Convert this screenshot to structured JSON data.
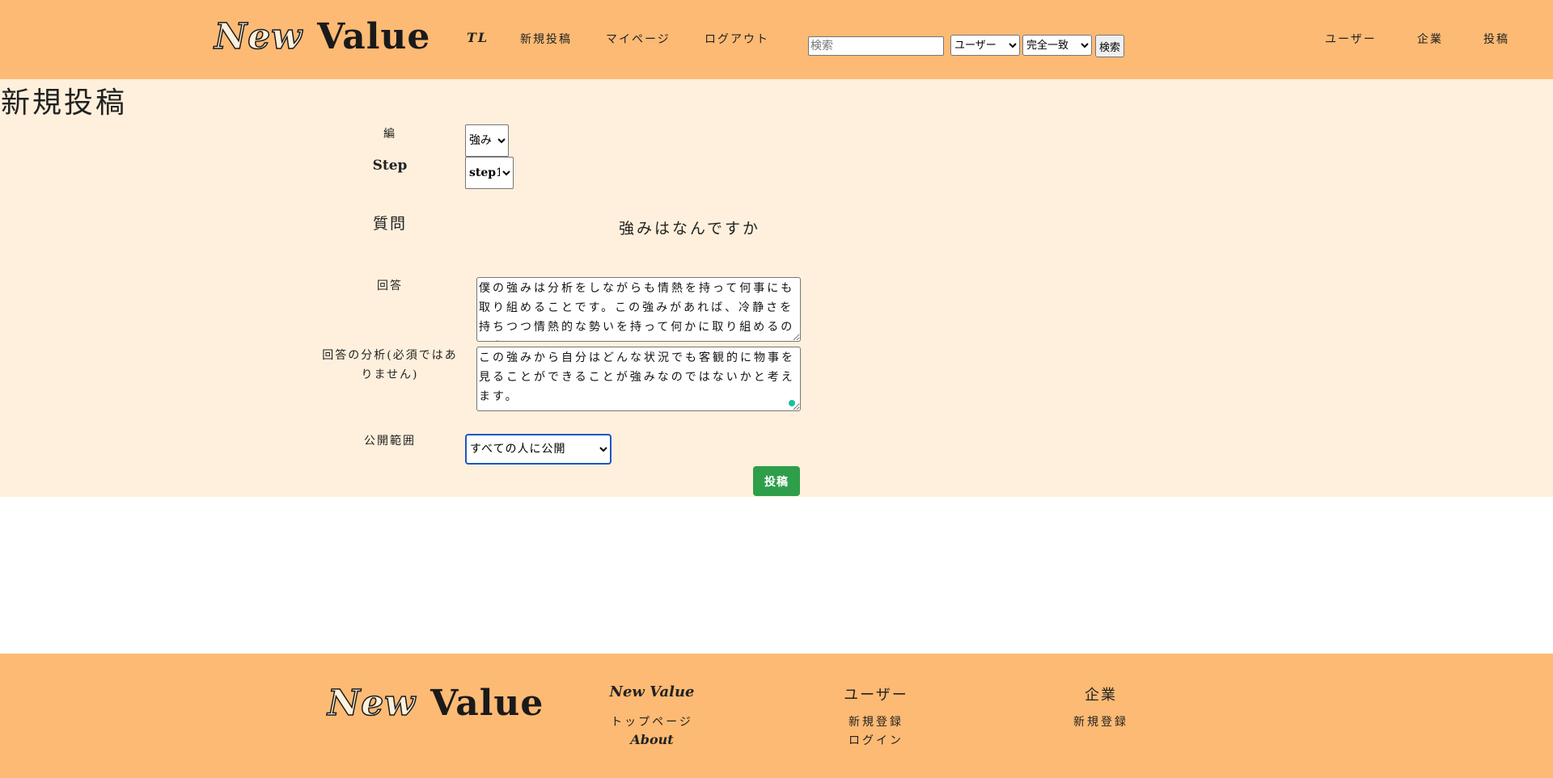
{
  "header": {
    "logo": {
      "word1": "New",
      "word2": "Value"
    },
    "nav": {
      "tl": "TL",
      "new_post": "新規投稿",
      "mypage": "マイページ",
      "logout": "ログアウト"
    },
    "search": {
      "placeholder": "検索",
      "type_selected": "ユーザー",
      "match_selected": "完全一致",
      "button": "検索"
    },
    "right_nav": {
      "users": "ユーザー",
      "companies": "企業",
      "posts": "投稿"
    }
  },
  "main": {
    "title": "新規投稿",
    "form": {
      "hen_label": "編",
      "hen_selected": "強み",
      "step_label": "Step",
      "step_selected": "step1",
      "question_label": "質問",
      "question_text": "強みはなんですか",
      "answer_label": "回答",
      "answer_value": "僕の強みは分析をしながらも情熱を持って何事にも取り組めることです。この強みがあれば、冷静さを持ちつつ情熱的な勢いを持って何かに取り組めるのである",
      "analysis_label": "回答の分析(必須ではありません)",
      "analysis_value": "この強みから自分はどんな状況でも客観的に物事を見ることができることが強みなのではないかと考えます。",
      "scope_label": "公開範囲",
      "scope_selected": "すべての人に公開",
      "submit": "投稿"
    }
  },
  "footer": {
    "logo": {
      "word1": "New",
      "word2": "Value"
    },
    "col1": {
      "heading": "New Value",
      "link1": "トップページ",
      "link2": "About"
    },
    "col2": {
      "heading": "ユーザー",
      "link1": "新規登録",
      "link2": "ログイン"
    },
    "col3": {
      "heading": "企業",
      "link1": "新規登録"
    }
  },
  "colors": {
    "header_bg": "#fdba74",
    "main_bg": "#fef0dc",
    "submit_btn": "#2e9e4a",
    "focus_outline": "#1a56c5"
  }
}
